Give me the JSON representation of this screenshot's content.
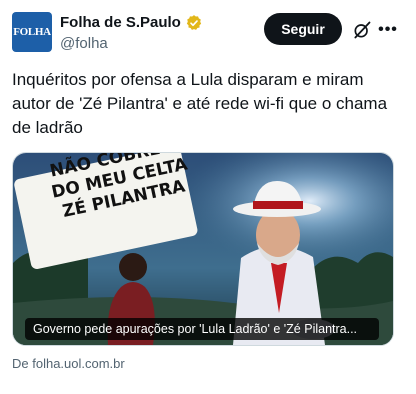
{
  "header": {
    "avatar_text": "FOLHA",
    "display_name": "Folha de S.Paulo",
    "handle": "@folha",
    "follow_label": "Seguir",
    "verified_icon": "gold-verified-badge",
    "grok_icon": "grok-icon",
    "more_icon": "more-horizontal-icon"
  },
  "tweet": {
    "text": "Inquéritos por ofensa a Lula disparam e miram autor de 'Zé Pilantra' e até rede wi-fi que o chama de ladrão"
  },
  "media": {
    "sign_text_lines": [
      "NÃO COBRE O",
      "DO MEU CELTA",
      "ZÉ PILANTRA"
    ],
    "caption": "Governo pede apurações por 'Lula Ladrão' e 'Zé Pilantra...",
    "source": "De folha.uol.com.br"
  },
  "colors": {
    "follow_bg": "#0f1419",
    "avatar_bg": "#1d5fa8",
    "verified": "#e2b719",
    "secondary_text": "#536471"
  }
}
